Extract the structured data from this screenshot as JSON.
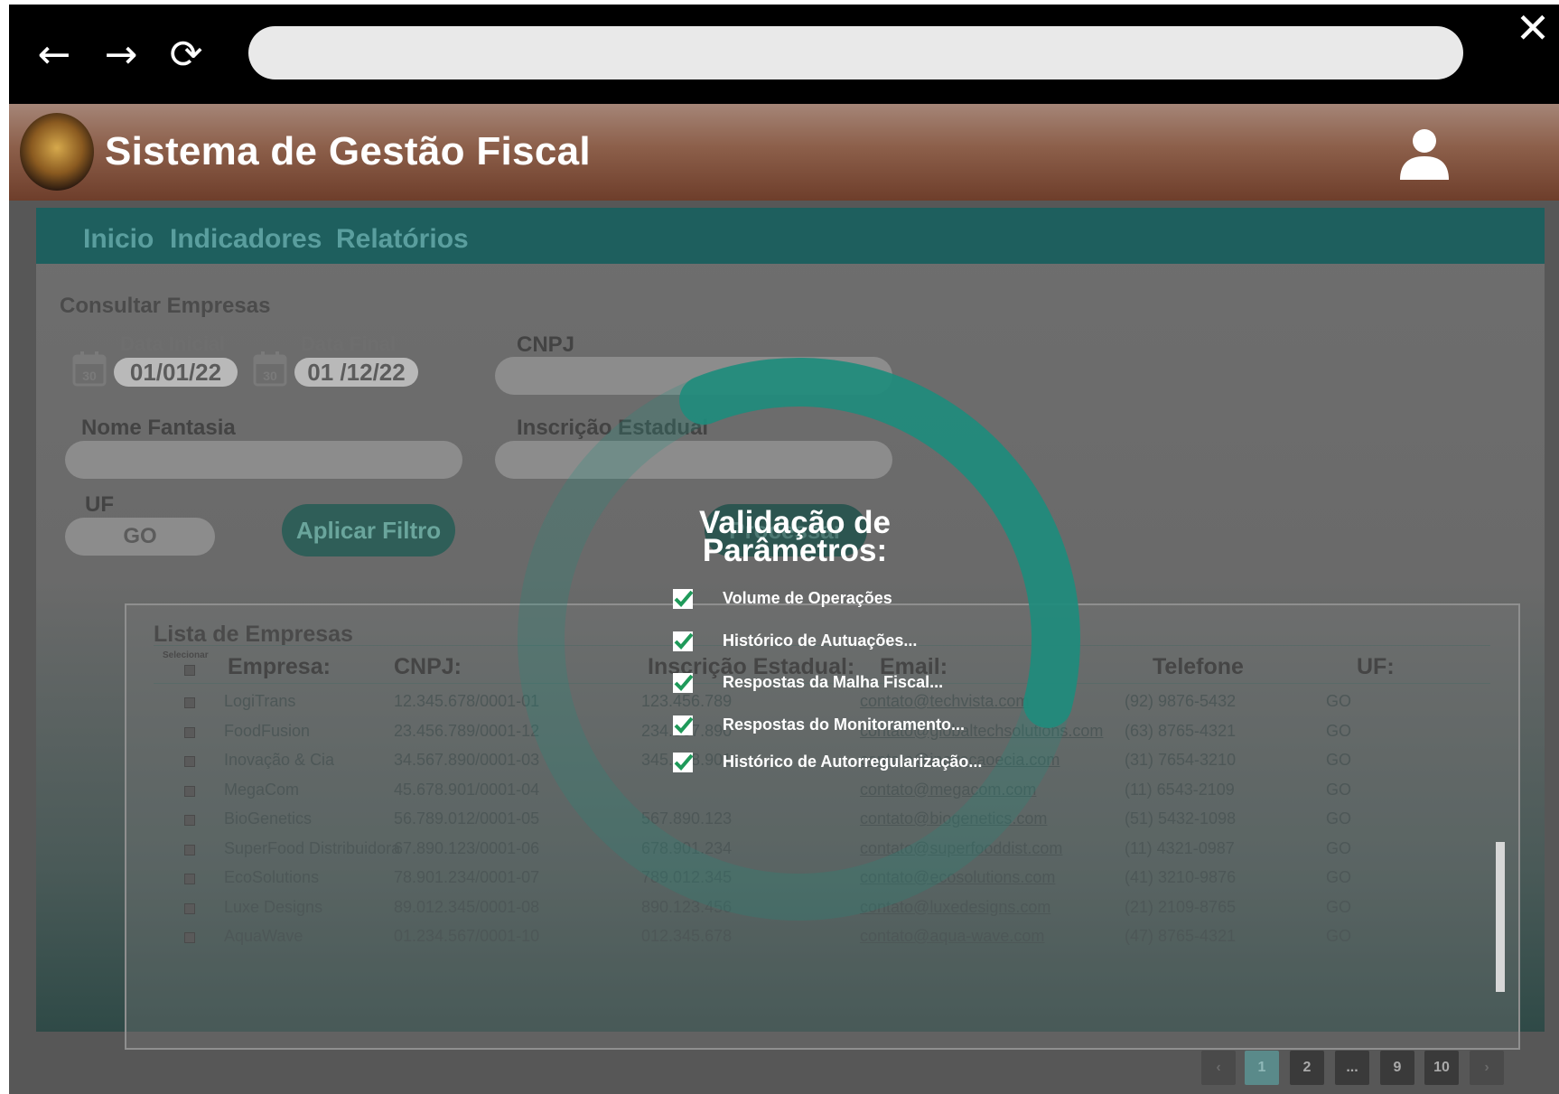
{
  "browser": {
    "back_icon": "←",
    "forward_icon": "→",
    "reload_icon": "⟳",
    "close_icon": "✕",
    "url": ""
  },
  "header": {
    "title": "Sistema de Gestão Fiscal"
  },
  "tabs": [
    "Inicio",
    "Indicadores",
    "Relatórios"
  ],
  "filter": {
    "title": "Consultar  Empresas",
    "date_start_label": "Data Inicial",
    "date_start": "01/01/22",
    "date_end_label": "Data Final",
    "date_end": "01 /12/22",
    "calendar_text": "30",
    "cnpj_label": "CNPJ",
    "nome_label": "Nome Fantasia",
    "ie_label": "Inscrição Estadual",
    "uf_label": "UF",
    "uf_value": "GO",
    "apply_button": "Aplicar Filtro",
    "other_button": "Processar"
  },
  "list": {
    "title": "Lista de Empresas",
    "select_label": "Selecionar",
    "headers": {
      "empresa": "Empresa:",
      "cnpj": "CNPJ:",
      "ie": "Inscrição Estadual:",
      "email": "Email:",
      "telefone": "Telefone",
      "uf": "UF:"
    },
    "rows": [
      {
        "empresa": "LogiTrans",
        "cnpj": "12.345.678/0001-01",
        "ie": "123.456.789",
        "email": "contato@techvista.com",
        "telefone": "(92) 9876-5432",
        "uf": "GO"
      },
      {
        "empresa": "FoodFusion",
        "cnpj": "23.456.789/0001-12",
        "ie": "234.567.890",
        "email": "contato@globaltechsolutions.com",
        "telefone": "(63) 8765-4321",
        "uf": "GO"
      },
      {
        "empresa": "Inovação & Cia",
        "cnpj": "34.567.890/0001-03",
        "ie": "345.678.901",
        "email": "contato@inovacaoecia.com",
        "telefone": "(31) 7654-3210",
        "uf": "GO"
      },
      {
        "empresa": "MegaCom",
        "cnpj": "45.678.901/0001-04",
        "ie": "",
        "email": "contato@megacom.com",
        "telefone": "(11) 6543-2109",
        "uf": "GO"
      },
      {
        "empresa": "BioGenetics",
        "cnpj": "56.789.012/0001-05",
        "ie": "567.890.123",
        "email": "contato@biogenetics.com",
        "telefone": "(51) 5432-1098",
        "uf": "GO"
      },
      {
        "empresa": "SuperFood Distribuidora",
        "cnpj": "67.890.123/0001-06",
        "ie": "678.901.234",
        "email": "contato@superfooddist.com",
        "telefone": "(11) 4321-0987",
        "uf": "GO"
      },
      {
        "empresa": "EcoSolutions",
        "cnpj": "78.901.234/0001-07",
        "ie": "789.012.345",
        "email": "contato@ecosolutions.com",
        "telefone": "(41) 3210-9876",
        "uf": "GO"
      },
      {
        "empresa": "Luxe Designs",
        "cnpj": "89.012.345/0001-08",
        "ie": "890.123.456",
        "email": "contato@luxedesigns.com",
        "telefone": "(21) 2109-8765",
        "uf": "GO"
      },
      {
        "empresa": "AquaWave",
        "cnpj": "01.234.567/0001-10",
        "ie": "012.345.678",
        "email": "contato@aqua-wave.com",
        "telefone": "(47) 8765-4321",
        "uf": "GO"
      }
    ]
  },
  "pagination": {
    "prev": "‹",
    "pages": [
      "1",
      "2",
      "...",
      "9",
      "10"
    ],
    "next": "›",
    "active": "1"
  },
  "modal": {
    "title_line1": "Validação de",
    "title_line2": "Parâmetros:",
    "items": [
      "Volume de Operações",
      "Histórico de Autuações...",
      "Respostas da Malha Fiscal...",
      "Respostas do Monitoramento...",
      "Histórico de Autorregularização..."
    ],
    "check_color": "#1f9a5a",
    "progress_fraction": 0.72
  },
  "colors": {
    "tab_bar": "#1e5f5e",
    "spinner": "#1f8c7c",
    "header_brown": "#8c5f4a"
  }
}
